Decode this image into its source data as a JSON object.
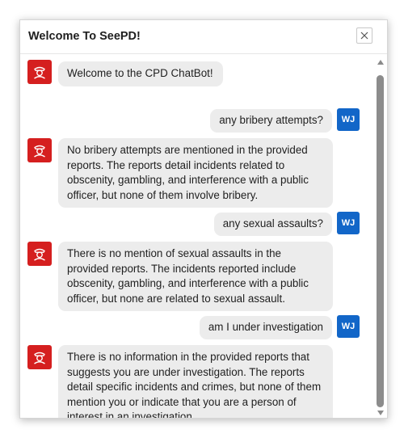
{
  "dialog": {
    "title": "Welcome To SeePD!",
    "close_icon": "close-icon"
  },
  "user": {
    "initials": "WJ"
  },
  "messages": [
    {
      "sender": "bot",
      "text": "Welcome to the CPD ChatBot!"
    },
    {
      "sender": "user",
      "text": "any bribery attempts?"
    },
    {
      "sender": "bot",
      "text": "No bribery attempts are mentioned in the provided reports. The reports detail incidents related to obscenity, gambling, and interference with a public officer, but none of them involve bribery."
    },
    {
      "sender": "user",
      "text": "any sexual assaults?"
    },
    {
      "sender": "bot",
      "text": "There is no mention of sexual assaults in the provided reports. The incidents reported include obscenity, gambling, and interference with a public officer, but none are related to sexual assault."
    },
    {
      "sender": "user",
      "text": "am I under investigation"
    },
    {
      "sender": "bot",
      "text": "There is no information in the provided reports that suggests you are under investigation. The reports detail specific incidents and crimes, but none of them mention you or indicate that you are a person of interest in an investigation."
    }
  ],
  "colors": {
    "bot_avatar": "#d51f1f",
    "user_avatar": "#1266c8",
    "bubble": "#ececec"
  },
  "icons": {
    "bot_avatar_icon": "police-officer-icon"
  }
}
